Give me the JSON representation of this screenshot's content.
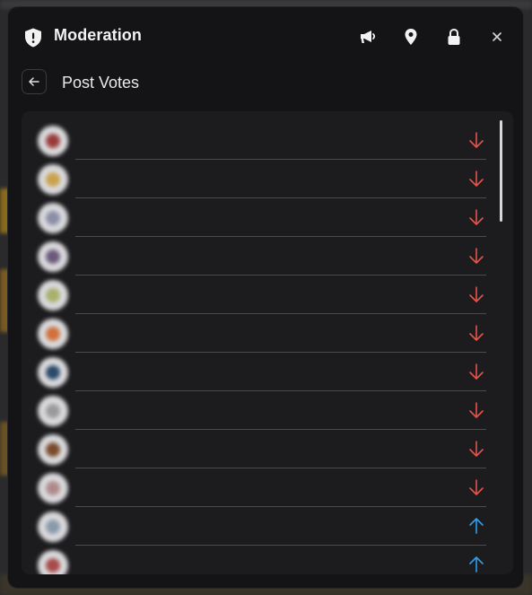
{
  "modal": {
    "title": "Moderation",
    "icons": [
      "shield-icon",
      "megaphone-icon",
      "location-pin-icon",
      "lock-icon",
      "close-icon"
    ]
  },
  "subheader": {
    "title": "Post Votes",
    "back_icon": "arrow-left-icon"
  },
  "colors": {
    "downvote": "#e5534b",
    "upvote": "#2d9ee8",
    "panel": "#1c1c1f",
    "modal": "#141416"
  },
  "votes": [
    {
      "name": "",
      "vote": "down",
      "avatar_color": "#9a3b3b"
    },
    {
      "name": "",
      "vote": "down",
      "avatar_color": "#c9a24a"
    },
    {
      "name": "",
      "vote": "down",
      "avatar_color": "#8a8fa8"
    },
    {
      "name": "",
      "vote": "down",
      "avatar_color": "#6b5a7a"
    },
    {
      "name": "",
      "vote": "down",
      "avatar_color": "#a8b06a"
    },
    {
      "name": "",
      "vote": "down",
      "avatar_color": "#d0703a"
    },
    {
      "name": "",
      "vote": "down",
      "avatar_color": "#2a4a6a"
    },
    {
      "name": "",
      "vote": "down",
      "avatar_color": "#9a9a9a"
    },
    {
      "name": "",
      "vote": "down",
      "avatar_color": "#7a4a2a"
    },
    {
      "name": "",
      "vote": "down",
      "avatar_color": "#b08a8a"
    },
    {
      "name": "",
      "vote": "up",
      "avatar_color": "#8a9aaa"
    },
    {
      "name": "",
      "vote": "up",
      "avatar_color": "#a84a4a"
    }
  ]
}
